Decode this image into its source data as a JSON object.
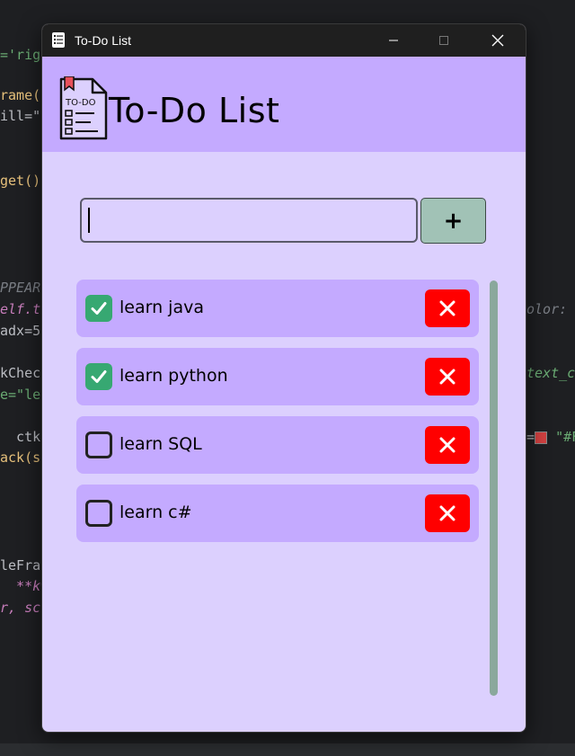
{
  "editor_snippets": {
    "l1": "='rig",
    "l2a": "rame(",
    "l3": "ill=\"",
    "l4": "get()",
    "l5": "PPEAR",
    "l6": "elf.t",
    "l6r": "olor: c",
    "l7": "adx=5",
    "l8": "kChec",
    "l8r": "text_c",
    "l9": "e=\"le",
    "l10": "  ctk.",
    "l10r": "\"#F",
    "l11": "ack(s",
    "l12": "leFra",
    "l13": "  **kw",
    "l14": "r, sc"
  },
  "window": {
    "title": "To-Do List"
  },
  "header": {
    "logo_text": "TO-DO",
    "title": "To-Do List"
  },
  "input": {
    "value": "",
    "placeholder": ""
  },
  "add_button_label": "+",
  "tasks": [
    {
      "label": "learn java",
      "checked": true
    },
    {
      "label": "learn python",
      "checked": true
    },
    {
      "label": "learn SQL",
      "checked": false
    },
    {
      "label": "learn c#",
      "checked": false
    }
  ],
  "colors": {
    "window_bg": "#dcd0fe",
    "header_bg": "#c4aaff",
    "add_button": "#a1c2b6",
    "delete_button": "#ff0000",
    "checked": "#37a872",
    "scrollbar": "#8aa89c"
  },
  "icons": {
    "app_icon": "todo-list-icon",
    "minimize": "minimize-icon",
    "maximize": "maximize-icon",
    "close": "close-icon",
    "check": "check-icon",
    "delete": "x-icon"
  }
}
